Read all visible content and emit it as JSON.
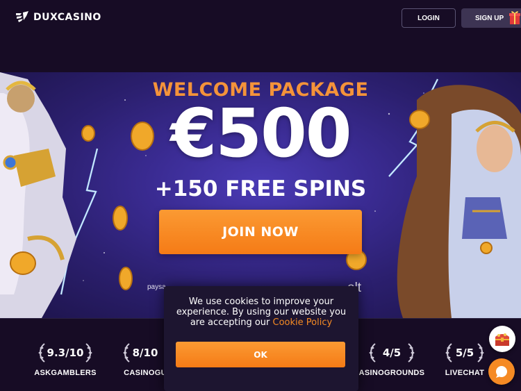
{
  "header": {
    "logo_text": "DUXCASINO",
    "login_label": "LOGIN",
    "signup_label": "SIGN UP"
  },
  "hero": {
    "title": "WELCOME PACKAGE",
    "amount": "€500",
    "spins": "+150 FREE SPINS",
    "join_label": "JOIN NOW",
    "payment_partial_1": "paysa",
    "payment_partial_2": "olt"
  },
  "ratings": [
    {
      "score": "9.3/10",
      "name": "ASKGAMBLERS"
    },
    {
      "score": "8/10",
      "name": "CASINOGU"
    },
    {
      "score": "4/5",
      "name": "ASINOGROUNDS"
    },
    {
      "score": "5/5",
      "name": "LIVECHAT"
    }
  ],
  "cookie": {
    "text": "We use cookies to improve your experience. By using our website you are accepting our",
    "link": "Cookie Policy",
    "ok_label": "OK"
  },
  "colors": {
    "accent": "#f58a24",
    "background": "#170c25",
    "hero": "#3a2b92"
  },
  "icons": {
    "logo": "dux-wing-icon",
    "gift": "gift-icon",
    "laurel": "laurel-icon",
    "treasure": "treasure-chest-icon",
    "chat": "chat-bubble-icon"
  }
}
